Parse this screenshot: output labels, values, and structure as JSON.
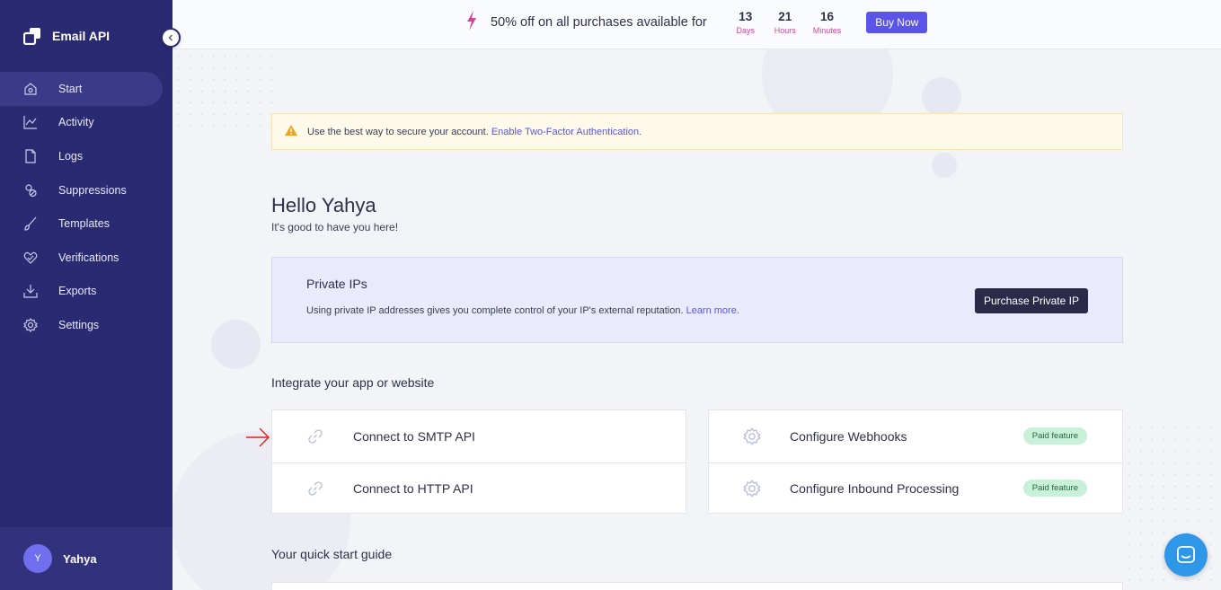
{
  "brand": {
    "name": "Email API"
  },
  "sidebar": {
    "items": [
      {
        "label": "Start",
        "icon": "home-icon",
        "active": true
      },
      {
        "label": "Activity",
        "icon": "chart-line-icon",
        "active": false
      },
      {
        "label": "Logs",
        "icon": "file-icon",
        "active": false
      },
      {
        "label": "Suppressions",
        "icon": "suppression-icon",
        "active": false
      },
      {
        "label": "Templates",
        "icon": "brush-icon",
        "active": false
      },
      {
        "label": "Verifications",
        "icon": "heart-check-icon",
        "active": false
      },
      {
        "label": "Exports",
        "icon": "download-icon",
        "active": false
      },
      {
        "label": "Settings",
        "icon": "gear-icon",
        "active": false
      }
    ],
    "user": {
      "initial": "Y",
      "name": "Yahya"
    }
  },
  "promo": {
    "text": "50% off on all purchases available for",
    "countdown": [
      {
        "value": "13",
        "label": "Days"
      },
      {
        "value": "21",
        "label": "Hours"
      },
      {
        "value": "16",
        "label": "Minutes"
      }
    ],
    "button": "Buy Now"
  },
  "alert": {
    "text": "Use the best way to secure your account.",
    "link": "Enable Two-Factor Authentication."
  },
  "greeting": {
    "title": "Hello Yahya",
    "subtitle": "It's good to have you here!"
  },
  "private_ips": {
    "title": "Private IPs",
    "description": "Using private IP addresses gives you complete control of your IP's external reputation.",
    "link": "Learn more.",
    "button": "Purchase Private IP"
  },
  "integrate": {
    "title": "Integrate your app or website",
    "left": [
      {
        "label": "Connect to SMTP API",
        "icon": "link-icon"
      },
      {
        "label": "Connect to HTTP API",
        "icon": "link-icon"
      }
    ],
    "right": [
      {
        "label": "Configure Webhooks",
        "icon": "gear-icon",
        "badge": "Paid feature"
      },
      {
        "label": "Configure Inbound Processing",
        "icon": "gear-icon",
        "badge": "Paid feature"
      }
    ]
  },
  "quick_start": {
    "title": "Your quick start guide"
  },
  "colors": {
    "sidebar": "#2a2a72",
    "accent": "#5b54e8",
    "promo_label": "#d1449b",
    "badge": "#c9f0d8"
  }
}
